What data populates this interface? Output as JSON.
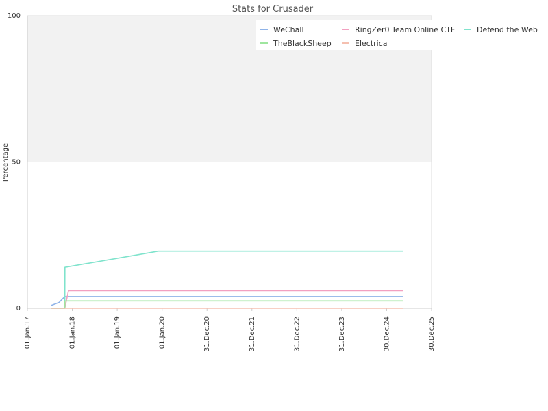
{
  "chart_data": {
    "type": "line",
    "title": "Stats for Crusader",
    "ylabel": "Percentage",
    "xlabel": "",
    "ylim": [
      0,
      100
    ],
    "y_ticks": [
      "0",
      "50",
      "100"
    ],
    "x_ticks": [
      {
        "label": "01.Jan.17",
        "date": "2017-01-01"
      },
      {
        "label": "01.Jan.18",
        "date": "2018-01-01"
      },
      {
        "label": "01.Jan.19",
        "date": "2019-01-01"
      },
      {
        "label": "01.Jan.20",
        "date": "2020-01-01"
      },
      {
        "label": "31.Dec.20",
        "date": "2020-12-31"
      },
      {
        "label": "31.Dec.21",
        "date": "2021-12-31"
      },
      {
        "label": "31.Dec.22",
        "date": "2022-12-31"
      },
      {
        "label": "31.Dec.23",
        "date": "2023-12-31"
      },
      {
        "label": "30.Dec.24",
        "date": "2024-12-30"
      },
      {
        "label": "30.Dec.25",
        "date": "2025-12-30"
      }
    ],
    "xlim": [
      "2017-01-01",
      "2025-12-30"
    ],
    "grid": true,
    "shaded_band": [
      50,
      100
    ],
    "legend_position": "top-right",
    "series": [
      {
        "name": "WeChall",
        "color": "#8fb3e8",
        "points": [
          [
            "2017-07-15",
            1
          ],
          [
            "2017-09-15",
            2
          ],
          [
            "2017-11-01",
            4
          ],
          [
            "2025-05-15",
            4
          ]
        ]
      },
      {
        "name": "RingZer0 Team Online CTF",
        "color": "#f2a0c0",
        "points": [
          [
            "2017-07-15",
            0
          ],
          [
            "2017-11-01",
            0
          ],
          [
            "2017-12-01",
            6
          ],
          [
            "2025-05-15",
            6
          ]
        ]
      },
      {
        "name": "Defend the Web",
        "color": "#7fe3cc",
        "points": [
          [
            "2017-07-15",
            0
          ],
          [
            "2017-11-01",
            0
          ],
          [
            "2017-11-02",
            14
          ],
          [
            "2019-12-01",
            19.5
          ],
          [
            "2025-05-15",
            19.5
          ]
        ]
      },
      {
        "name": "TheBlackSheep",
        "color": "#9fe69f",
        "points": [
          [
            "2017-07-15",
            0
          ],
          [
            "2017-11-01",
            0
          ],
          [
            "2017-11-02",
            2.5
          ],
          [
            "2025-05-15",
            2.5
          ]
        ]
      },
      {
        "name": "Electrica",
        "color": "#f5c0b0",
        "points": [
          [
            "2017-07-15",
            0
          ],
          [
            "2025-05-15",
            0
          ]
        ]
      }
    ]
  }
}
